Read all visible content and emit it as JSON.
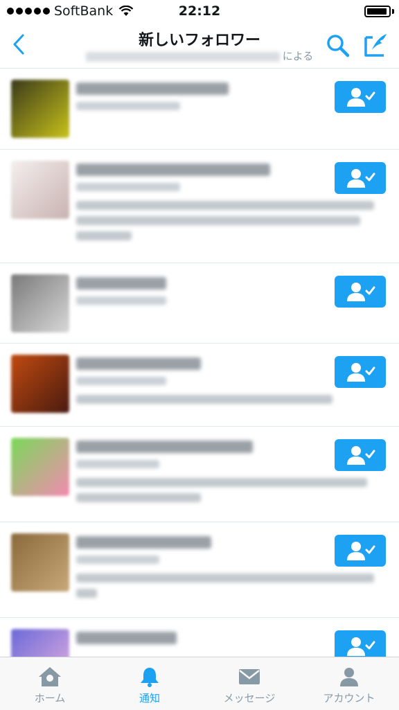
{
  "status_bar": {
    "carrier": "SoftBank",
    "time": "22:12"
  },
  "nav": {
    "title": "新しいフォロワー",
    "subtitle_suffix": "による"
  },
  "colors": {
    "accent": "#1da1f2",
    "muted": "#8899a6"
  },
  "follow_icon": "person-check-icon",
  "rows": [
    {
      "height": 117,
      "avatar_colors": [
        "#3a3a1a",
        "#c8c21a"
      ],
      "name_w": 220,
      "handle_w": 150,
      "bio_lines": []
    },
    {
      "height": 164,
      "avatar_colors": [
        "#f4eeee",
        "#c8b3b0"
      ],
      "name_w": 280,
      "handle_w": 150,
      "bio_lines": [
        430,
        410,
        80
      ]
    },
    {
      "height": 116,
      "avatar_colors": [
        "#7a7a7a",
        "#d8d8d8"
      ],
      "name_w": 130,
      "handle_w": 130,
      "bio_lines": []
    },
    {
      "height": 120,
      "avatar_colors": [
        "#c04a10",
        "#4a1a10"
      ],
      "name_w": 180,
      "handle_w": 130,
      "bio_lines": [
        370
      ]
    },
    {
      "height": 138,
      "avatar_colors": [
        "#7ad85a",
        "#f28ab0"
      ],
      "name_w": 255,
      "handle_w": 120,
      "bio_lines": [
        420,
        180
      ]
    },
    {
      "height": 138,
      "avatar_colors": [
        "#8a6a3a",
        "#c8a878"
      ],
      "name_w": 195,
      "handle_w": 120,
      "bio_lines": [
        430,
        30
      ]
    },
    {
      "height": 60,
      "avatar_colors": [
        "#6a6ad8",
        "#e8b0e0"
      ],
      "name_w": 145,
      "handle_w": 0,
      "bio_lines": []
    }
  ],
  "tabs": [
    {
      "label": "ホーム",
      "icon": "home-icon",
      "active": false
    },
    {
      "label": "通知",
      "icon": "bell-icon",
      "active": true
    },
    {
      "label": "メッセージ",
      "icon": "envelope-icon",
      "active": false
    },
    {
      "label": "アカウント",
      "icon": "person-icon",
      "active": false
    }
  ]
}
